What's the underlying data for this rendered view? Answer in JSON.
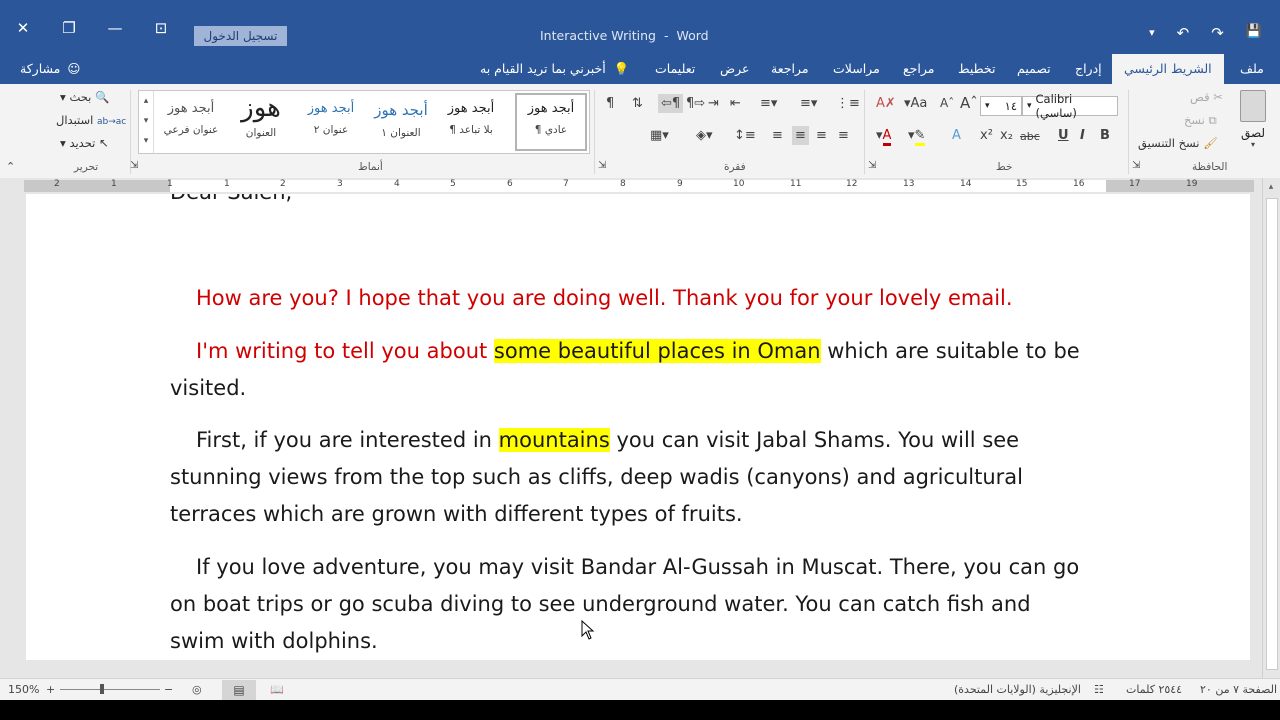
{
  "window": {
    "title": "Interactive Writing",
    "app": "Word",
    "separator": "-",
    "signin_label": "تسجيل الدخول",
    "close_glyph": "✕",
    "restore_glyph": "❐",
    "minimize_glyph": "—",
    "ribbon_display_glyph": "⊡"
  },
  "qat": {
    "save": "💾",
    "redo": "↷",
    "undo": "↶",
    "customize": "▾"
  },
  "tabs": {
    "share": "مشاركة",
    "tell_me": "أخبرني بما تريد القيام به",
    "items": [
      "ملف",
      "الشريط الرئيسي",
      "إدراج",
      "تصميم",
      "تخطيط",
      "مراجع",
      "مراسلات",
      "مراجعة",
      "عرض",
      "تعليمات"
    ],
    "active": "الشريط الرئيسي"
  },
  "ribbon": {
    "clipboard": {
      "label": "الحافظة",
      "paste": "لصق",
      "cut": "قص",
      "copy": "نسخ",
      "format_painter": "نسخ التنسيق"
    },
    "font": {
      "label": "خط",
      "name": "Calibri (ساسي)",
      "size": "١٤",
      "bold": "B",
      "italic": "I",
      "underline": "U",
      "strike": "abc",
      "subscript": "x₂",
      "superscript": "x²",
      "grow": "A",
      "shrink": "A",
      "case": "Aa"
    },
    "paragraph": {
      "label": "فقرة",
      "show_marks": "¶"
    },
    "styles": {
      "label": "أنماط",
      "items": [
        {
          "preview": "أبجد هوز",
          "name": "¶ عادي"
        },
        {
          "preview": "أبجد هوز",
          "name": "¶ بلا تباعد"
        },
        {
          "preview": "أبجد هوز",
          "name": "العنوان ١"
        },
        {
          "preview": "أبجد هوز",
          "name": "عنوان ٢"
        },
        {
          "preview": "هوز",
          "name": "العنوان"
        },
        {
          "preview": "أبجد هوز",
          "name": "عنوان فرعي"
        }
      ]
    },
    "editing": {
      "label": "تحرير",
      "find": "بحث",
      "replace": "استبدال",
      "select": "تحديد"
    }
  },
  "ruler": {
    "numbers": [
      "2",
      "1",
      "1",
      "1",
      "2",
      "3",
      "4",
      "5",
      "6",
      "7",
      "8",
      "9",
      "10",
      "11",
      "12",
      "13",
      "14",
      "15",
      "16",
      "17",
      "19"
    ]
  },
  "document": {
    "top_partial": "Dear Saleh,",
    "p1": "How are you? I hope that you are doing well. Thank you for your lovely email.",
    "p2_red": "I'm writing to tell you about ",
    "p2_hl": "some beautiful places in Oman",
    "p2_rest": " which are suitable to be visited.",
    "p3_a": "First, if you are interested in ",
    "p3_hl": "mountains",
    "p3_b": " you can visit Jabal Shams. You will see stunning views from the top such as cliffs, deep wadis (canyons) and agricultural terraces which are grown with different types of fruits.",
    "p4": "If you love adventure, you may visit Bandar Al-Gussah in Muscat. There, you can go on boat trips or go scuba diving to see underground water. You can catch fish and swim with dolphins."
  },
  "status": {
    "page": "الصفحة ٧ من ٢٠",
    "words": "٢٥٤٤ كلمات",
    "language": "الإنجليزية (الولايات المتحدة)",
    "zoom": "150%",
    "zoom_plus": "+",
    "zoom_minus": "−"
  },
  "colors": {
    "accent": "#2b579a",
    "red_text": "#d00000",
    "highlight": "#ffff00"
  }
}
